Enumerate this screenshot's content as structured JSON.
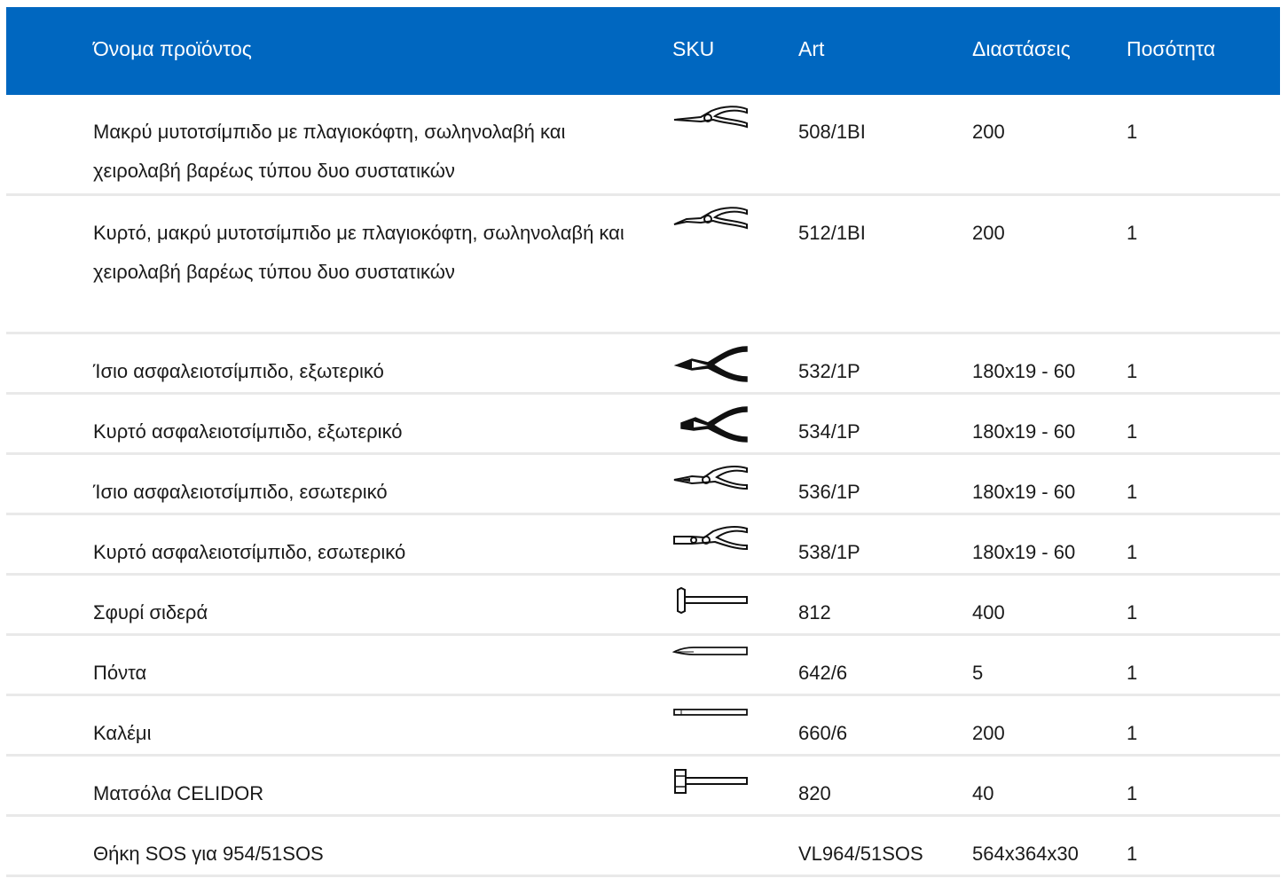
{
  "table": {
    "headers": {
      "name": "Όνομα προϊόντος",
      "sku": "SKU",
      "art": "Art",
      "dimensions": "Διαστάσεις",
      "quantity": "Ποσότητα"
    },
    "header_color": "#0067c0",
    "rows": [
      {
        "name": "Μακρύ μυτοτσίμπιδο με πλαγιοκόφτη, σωληνολαβή και χειρολαβή βαρέως τύπου δυο συστατικών",
        "icon": "long-nose-pliers-icon",
        "art": "508/1BI",
        "dimensions": "200",
        "quantity": "1"
      },
      {
        "name": "Κυρτό, μακρύ μυτοτσίμπιδο με πλαγιοκόφτη, σωληνολαβή και χειρολαβή βαρέως τύπου δυο συστατικών",
        "icon": "bent-long-nose-pliers-icon",
        "art": "512/1BI",
        "dimensions": "200",
        "quantity": "1"
      },
      {
        "name": "Ίσιο ασφαλειοτσίμπιδο, εξωτερικό",
        "icon": "straight-external-circlip-pliers-icon",
        "art": "532/1P",
        "dimensions": "180x19 - 60",
        "quantity": "1"
      },
      {
        "name": "Κυρτό ασφαλειοτσίμπιδο, εξωτερικό",
        "icon": "bent-external-circlip-pliers-icon",
        "art": "534/1P",
        "dimensions": "180x19 - 60",
        "quantity": "1"
      },
      {
        "name": "Ίσιο ασφαλειοτσίμπιδο, εσωτερικό",
        "icon": "straight-internal-circlip-pliers-icon",
        "art": "536/1P",
        "dimensions": "180x19 - 60",
        "quantity": "1"
      },
      {
        "name": "Κυρτό ασφαλειοτσίμπιδο, εσωτερικό",
        "icon": "bent-internal-circlip-pliers-icon",
        "art": "538/1P",
        "dimensions": "180x19 - 60",
        "quantity": "1"
      },
      {
        "name": "Σφυρί σιδερά",
        "icon": "hammer-icon",
        "art": "812",
        "dimensions": "400",
        "quantity": "1"
      },
      {
        "name": "Πόντα",
        "icon": "punch-icon",
        "art": "642/6",
        "dimensions": "5",
        "quantity": "1"
      },
      {
        "name": "Καλέμι",
        "icon": "chisel-icon",
        "art": "660/6",
        "dimensions": "200",
        "quantity": "1"
      },
      {
        "name": "Ματσόλα CELIDOR",
        "icon": "mallet-icon",
        "art": "820",
        "dimensions": "40",
        "quantity": "1"
      },
      {
        "name": "Θήκη SOS για 954/51SOS",
        "icon": "",
        "art": "VL964/51SOS",
        "dimensions": "564x364x30",
        "quantity": "1"
      }
    ]
  }
}
